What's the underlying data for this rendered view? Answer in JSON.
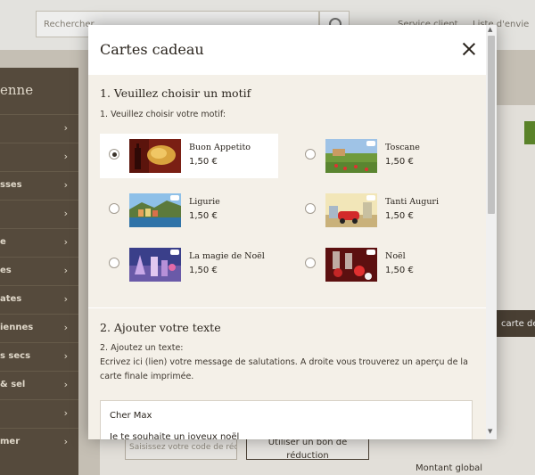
{
  "background": {
    "search_placeholder": "Rechercher ...",
    "top_links": [
      "Service client",
      "Liste d'envie"
    ],
    "sidebar_title": "enne",
    "sidebar_items": [
      "",
      "",
      "sses",
      "",
      "e",
      "es",
      "ates",
      "iennes",
      "s secs",
      "& sel",
      "",
      "mer"
    ],
    "dark_button": "carte de",
    "code_placeholder": "Saisissez votre code de réd",
    "voucher_button": "Utiliser un bon de réduction",
    "total_label": "Montant global"
  },
  "modal": {
    "title": "Cartes cadeau",
    "section1": {
      "title": "1. Veuillez choisir un motif",
      "subtitle": "1. Veuillez choisir votre motif:"
    },
    "motifs": [
      {
        "name": "Buon Appetito",
        "price": "1,50 €",
        "selected": true
      },
      {
        "name": "Toscane",
        "price": "1,50 €",
        "selected": false
      },
      {
        "name": "Ligurie",
        "price": "1,50 €",
        "selected": false
      },
      {
        "name": "Tanti Auguri",
        "price": "1,50 €",
        "selected": false
      },
      {
        "name": "La magie de Noël",
        "price": "1,50 €",
        "selected": false
      },
      {
        "name": "Noël",
        "price": "1,50 €",
        "selected": false
      }
    ],
    "section2": {
      "title": "2. Ajouter votre texte",
      "subtitle": "2. Ajoutez un texte:",
      "description": "Ecrivez ici (lien) votre message de salutations. A droite vous trouverez un aperçu de la carte finale imprimée.",
      "message_line1": "Cher Max",
      "message_line2": "Je te souhaite un joyeux noël"
    }
  },
  "colors": {
    "accent_green": "#5f8a2b",
    "sidebar_brown": "#5a4e3f",
    "modal_bg": "#f4f0e8"
  }
}
